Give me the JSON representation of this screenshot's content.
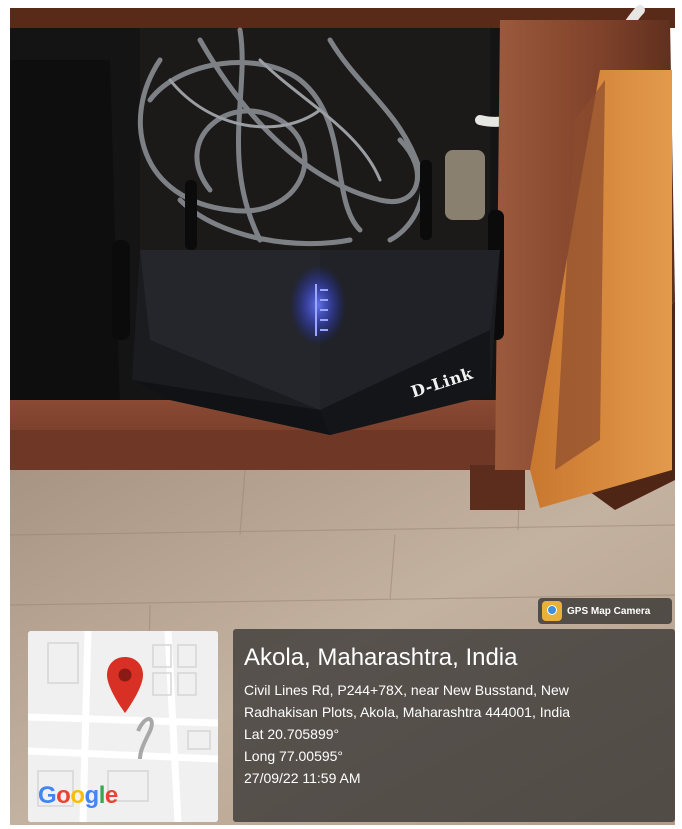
{
  "badge": {
    "text": "GPS Map Camera",
    "icon": "gps-map-camera-app-icon"
  },
  "map": {
    "brand": "Google",
    "marker_icon": "map-pin-icon"
  },
  "location": {
    "title": "Akola, Maharashtra, India",
    "address_line1": "Civil Lines Rd, P244+78X, near New Busstand, New",
    "address_line2": "Radhakisan Plots, Akola, Maharashtra 444001, India",
    "lat": "Lat 20.705899°",
    "long": "Long 77.00595°",
    "timestamp": "27/09/22 11:59 AM"
  },
  "router_label": "D-Link",
  "colors": {
    "pin": "#d93025",
    "led": "#3a4dff",
    "panel": "#2d2d2d"
  }
}
